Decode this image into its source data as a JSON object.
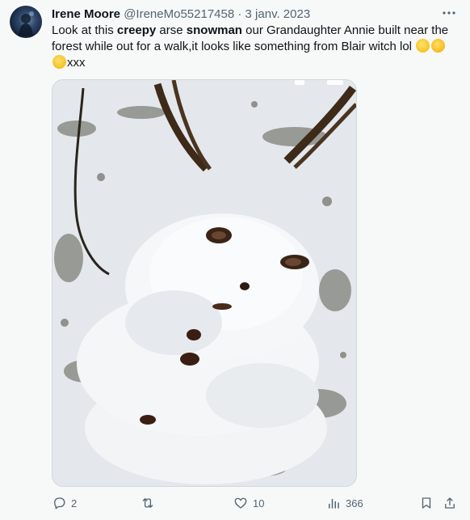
{
  "tweet": {
    "author_name": "Irene Moore",
    "handle": "@IreneMo55217458",
    "separator": "·",
    "date": "3 janv. 2023",
    "text_parts": {
      "p1": "Look at this ",
      "b1": "creepy",
      "p2": " arse ",
      "b2": "snowman",
      "p3": " our Grandaughter Annie built near the forest while out for a walk,it looks like something from Blair witch lol ",
      "p4": "xxx"
    },
    "emojis": [
      "face-with-rolling-eyes",
      "face-with-tears-of-joy",
      "astonished-face"
    ],
    "media_alt_icon": "snowman-photo"
  },
  "actions": {
    "reply_count": "2",
    "retweet_count": "",
    "like_count": "10",
    "views_count": "366"
  },
  "colors": {
    "text": "#0f1419",
    "secondary": "#536471",
    "background": "#f7f9f9",
    "border": "#cfd9de"
  }
}
